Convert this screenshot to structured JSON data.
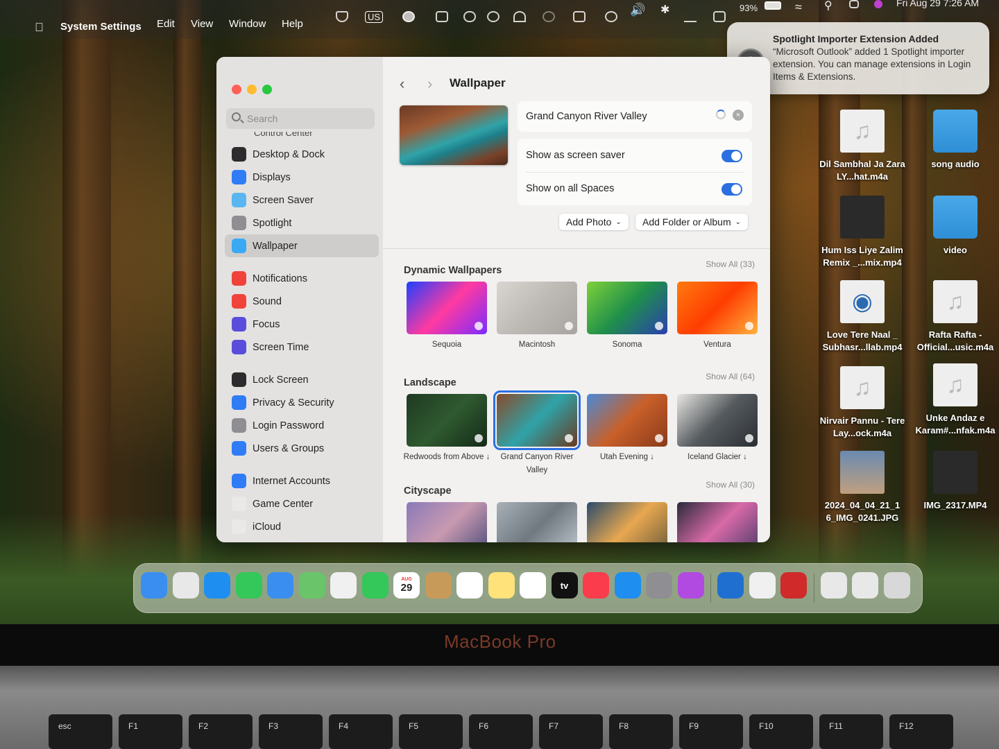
{
  "menubar": {
    "app_name": "System Settings",
    "menus": [
      "Edit",
      "View",
      "Window",
      "Help"
    ],
    "input_source": "US",
    "battery": "93%",
    "datetime": "Fri Aug 29  7:26 AM"
  },
  "notification": {
    "title": "Spotlight Importer Extension Added",
    "body": "“Microsoft Outlook” added 1 Spotlight importer extension. You can manage extensions in Login Items & Extensions."
  },
  "sidebar": {
    "search_placeholder": "Search",
    "partial_item": "Control Center",
    "groups": [
      [
        {
          "label": "Desktop & Dock",
          "icon": "dock-icon",
          "color": "#2c2c2e"
        },
        {
          "label": "Displays",
          "icon": "display-icon",
          "color": "#2f7cf6"
        },
        {
          "label": "Screen Saver",
          "icon": "screen-saver-icon",
          "color": "#5ab6f0"
        },
        {
          "label": "Spotlight",
          "icon": "magnifier-icon",
          "color": "#8e8e93"
        },
        {
          "label": "Wallpaper",
          "icon": "flower-icon",
          "color": "#39a9f4",
          "active": true
        }
      ],
      [
        {
          "label": "Notifications",
          "icon": "bell-icon",
          "color": "#f0443a"
        },
        {
          "label": "Sound",
          "icon": "speaker-icon",
          "color": "#f0443a"
        },
        {
          "label": "Focus",
          "icon": "moon-icon",
          "color": "#5a4ddb"
        },
        {
          "label": "Screen Time",
          "icon": "hourglass-icon",
          "color": "#5a4ddb"
        }
      ],
      [
        {
          "label": "Lock Screen",
          "icon": "lock-icon",
          "color": "#2c2c2e"
        },
        {
          "label": "Privacy & Security",
          "icon": "hand-icon",
          "color": "#2f7cf6"
        },
        {
          "label": "Login Password",
          "icon": "key-lock-icon",
          "color": "#8e8e93"
        },
        {
          "label": "Users & Groups",
          "icon": "users-icon",
          "color": "#2f7cf6"
        }
      ],
      [
        {
          "label": "Internet Accounts",
          "icon": "at-icon",
          "color": "#2f7cf6"
        },
        {
          "label": "Game Center",
          "icon": "game-center-icon",
          "color": "#e9e9e9"
        },
        {
          "label": "iCloud",
          "icon": "cloud-icon",
          "color": "#e9e9e9"
        }
      ]
    ]
  },
  "pane": {
    "title": "Wallpaper",
    "current_wallpaper": "Grand Canyon River Valley",
    "toggles": [
      {
        "label": "Show as screen saver",
        "on": true
      },
      {
        "label": "Show on all Spaces",
        "on": true
      }
    ],
    "add_photo": "Add Photo",
    "add_folder": "Add Folder or Album",
    "sections": [
      {
        "title": "Dynamic Wallpapers",
        "show_all": "Show All (33)",
        "items": [
          {
            "label": "Sequoia",
            "colors": [
              "#2040ff",
              "#ff3aa0",
              "#7a2cff"
            ]
          },
          {
            "label": "Macintosh",
            "colors": [
              "#d9d6d2",
              "#bdb9b4",
              "#a8a4a0"
            ]
          },
          {
            "label": "Sonoma",
            "colors": [
              "#7fd23a",
              "#1f8f4a",
              "#2a3fb0"
            ]
          },
          {
            "label": "Ventura",
            "colors": [
              "#ff7a10",
              "#ff3d00",
              "#ffb340"
            ]
          }
        ]
      },
      {
        "title": "Landscape",
        "show_all": "Show All (64)",
        "items": [
          {
            "label": "Redwoods from Above ↓",
            "colors": [
              "#1f3a22",
              "#2f5a30",
              "#142a18"
            ]
          },
          {
            "label": "Grand Canyon River Valley",
            "colors": [
              "#8a4a2a",
              "#2fa3a8",
              "#6a3a22"
            ],
            "selected": true
          },
          {
            "label": "Utah Evening ↓",
            "colors": [
              "#4a8ad8",
              "#c8602a",
              "#8a3a1a"
            ]
          },
          {
            "label": "Iceland Glacier ↓",
            "colors": [
              "#e8e6e2",
              "#555a5e",
              "#2a2e32"
            ]
          }
        ]
      },
      {
        "title": "Cityscape",
        "show_all": "Show All (30)",
        "items": [
          {
            "label": "",
            "colors": [
              "#8a7ab8",
              "#c89ab0",
              "#4a4a7a"
            ]
          },
          {
            "label": "",
            "colors": [
              "#a8b0b8",
              "#707880",
              "#c0c8d0"
            ]
          },
          {
            "label": "",
            "colors": [
              "#2a4a6a",
              "#e8a850",
              "#6a5a3a"
            ]
          },
          {
            "label": "",
            "colors": [
              "#2a2a3a",
              "#d86aa8",
              "#4a3a6a"
            ]
          }
        ]
      }
    ]
  },
  "desktop_files": [
    {
      "label": "Dil Sambhal Ja Zara  LY...hat.m4a",
      "kind": "music-file-icon"
    },
    {
      "label": "song audio",
      "kind": "folder-icon"
    },
    {
      "label": "Hum Iss Liye Zalim Remix _...mix.mp4",
      "kind": "video-file-icon"
    },
    {
      "label": "video",
      "kind": "folder-icon"
    },
    {
      "label": "Love Tere Naal _ Subhasr...llab.mp4",
      "kind": "quicktime-file-icon"
    },
    {
      "label": "Rafta Rafta - Official...usic.m4a",
      "kind": "music-file-icon"
    },
    {
      "label": "Nirvair Pannu - Tere Lay...ock.m4a",
      "kind": "music-file-icon"
    },
    {
      "label": "Unke Andaz e Karam#...nfak.m4a",
      "kind": "music-file-icon"
    },
    {
      "label": "2024_04_04_21_1 6_IMG_0241.JPG",
      "kind": "photo-file-icon"
    },
    {
      "label": "IMG_2317.MP4",
      "kind": "video-file-icon"
    }
  ],
  "dock": {
    "calendar_month": "AUG",
    "calendar_day": "29",
    "tv_label": "tv",
    "apps": [
      {
        "name": "finder-icon",
        "color": "#3a8ef0"
      },
      {
        "name": "launchpad-icon",
        "color": "#e8e8e8"
      },
      {
        "name": "safari-icon",
        "color": "#1e8ef0"
      },
      {
        "name": "messages-icon",
        "color": "#34c759"
      },
      {
        "name": "mail-icon",
        "color": "#3a8ef0"
      },
      {
        "name": "maps-icon",
        "color": "#6ac46a"
      },
      {
        "name": "photos-icon",
        "color": "#f0f0f0"
      },
      {
        "name": "facetime-icon",
        "color": "#34c759"
      },
      {
        "name": "calendar-icon",
        "color": "#ffffff"
      },
      {
        "name": "contacts-icon",
        "color": "#c89a5a"
      },
      {
        "name": "reminders-icon",
        "color": "#ffffff"
      },
      {
        "name": "notes-icon",
        "color": "#ffe27a"
      },
      {
        "name": "freeform-icon",
        "color": "#ffffff"
      },
      {
        "name": "apple-tv-icon",
        "color": "#111111"
      },
      {
        "name": "music-icon",
        "color": "#fa3c4c"
      },
      {
        "name": "app-store-icon",
        "color": "#1e8ef0"
      },
      {
        "name": "system-settings-icon",
        "color": "#8e8e93"
      },
      {
        "name": "feedback-icon",
        "color": "#b04ae0"
      },
      {
        "name": "defender-icon",
        "color": "#1e6fd0"
      },
      {
        "name": "chrome-icon",
        "color": "#f0f0f0"
      },
      {
        "name": "photo-booth-icon",
        "color": "#d02a2a"
      },
      {
        "name": "downloads-stack-icon",
        "color": "#e8e8e8"
      },
      {
        "name": "screenshots-stack-icon",
        "color": "#e8e8e8"
      },
      {
        "name": "trash-icon",
        "color": "#d8d8d8"
      }
    ]
  },
  "laptop": {
    "brand": "MacBook Pro",
    "keys": [
      "esc",
      "F1",
      "F2",
      "F3",
      "F4",
      "F5",
      "F6",
      "F7",
      "F8",
      "F9",
      "F10",
      "F11",
      "F12"
    ]
  }
}
